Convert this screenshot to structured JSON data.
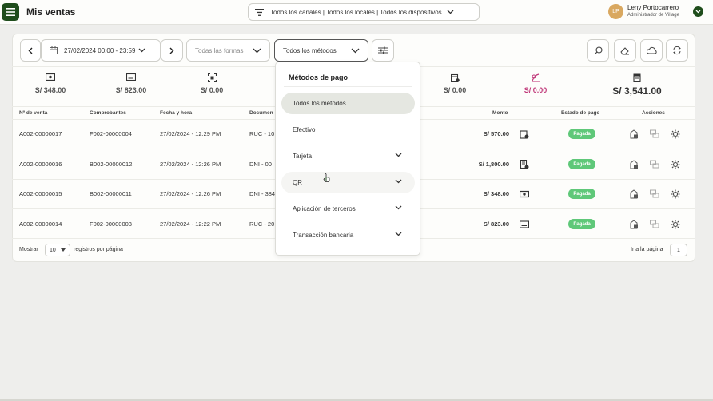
{
  "header": {
    "title": "Mis ventas",
    "channels_filter": "Todos los canales | Todos los locales | Todos los dispositivos",
    "user": {
      "initials": "LP",
      "name": "Leny Portocarrero",
      "role": "Administrador de Village"
    }
  },
  "filters": {
    "date_range": "27/02/2024 00:00 - 23:59",
    "forms": "Todas las formas",
    "methods": "Todos los métodos"
  },
  "stats": [
    {
      "icon": "cash-icon",
      "value": "S/ 348.00"
    },
    {
      "icon": "receipt-icon",
      "value": "S/ 823.00"
    },
    {
      "icon": "qr-scan-icon",
      "value": "S/ 0.00"
    },
    {
      "icon": "calendar-badge-icon",
      "value": "S/ 0.00"
    },
    {
      "icon": "cancel-payment-icon",
      "value": "S/ 0.00"
    },
    {
      "icon": "total-icon",
      "value": "S/ 3,541.00"
    }
  ],
  "table": {
    "columns": [
      "Nº de venta",
      "Comprobantes",
      "Fecha y hora",
      "Documen",
      "Monto",
      "Estado de pago",
      "Acciones"
    ],
    "rows": [
      {
        "sale": "A002-00000017",
        "voucher": "F002-00000004",
        "datetime": "27/02/2024 - 12:29 PM",
        "doc": "RUC - 10",
        "amount": "S/ 570.00",
        "status": "Pagada"
      },
      {
        "sale": "A002-00000016",
        "voucher": "B002-00000012",
        "datetime": "27/02/2024 - 12:26 PM",
        "doc": "DNI - 00",
        "amount": "S/ 1,800.00",
        "status": "Pagada"
      },
      {
        "sale": "A002-00000015",
        "voucher": "B002-00000011",
        "datetime": "27/02/2024 - 12:26 PM",
        "doc": "DNI - 384",
        "amount": "S/ 348.00",
        "status": "Pagada"
      },
      {
        "sale": "A002-00000014",
        "voucher": "F002-00000003",
        "datetime": "27/02/2024 - 12:22 PM",
        "doc": "RUC - 20",
        "amount": "S/ 823.00",
        "status": "Pagada"
      }
    ]
  },
  "pagination": {
    "show_label": "Mostrar",
    "page_size": "10",
    "per_page_label": "registros por página",
    "goto_label": "Ir a la página",
    "page": "1"
  },
  "dropdown": {
    "title": "Métodos de pago",
    "items": [
      {
        "label": "Todos los métodos"
      },
      {
        "label": "Efectivo"
      },
      {
        "label": "Tarjeta"
      },
      {
        "label": "QR"
      },
      {
        "label": "Aplicación de terceros"
      },
      {
        "label": "Transacción bancaria"
      }
    ]
  },
  "colors": {
    "brand": "#1f4d1c",
    "paid": "#5fc879",
    "accent_pink": "#c0397a"
  }
}
